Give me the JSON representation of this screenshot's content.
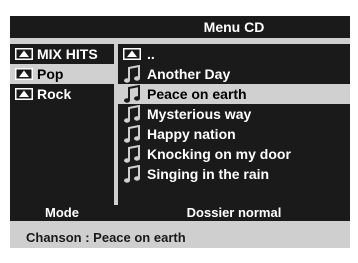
{
  "header": {
    "title": "Menu CD"
  },
  "folders": [
    {
      "label": "MIX HITS",
      "icon": "folder-icon"
    },
    {
      "label": "Pop",
      "icon": "folder-icon",
      "selected": true
    },
    {
      "label": "Rock",
      "icon": "folder-icon"
    }
  ],
  "tracks": [
    {
      "label": "..",
      "icon": "parent-folder-icon"
    },
    {
      "label": "Another Day",
      "icon": "music-note-icon"
    },
    {
      "label": "Peace on earth",
      "icon": "music-note-icon",
      "selected": true
    },
    {
      "label": "Mysterious way",
      "icon": "music-note-icon"
    },
    {
      "label": "Happy nation",
      "icon": "music-note-icon"
    },
    {
      "label": "Knocking on my door",
      "icon": "music-note-icon"
    },
    {
      "label": "Singing in the rain",
      "icon": "music-note-icon"
    }
  ],
  "footer": {
    "mode_label": "Mode",
    "mode_value": "Dossier normal"
  },
  "status": {
    "text": "Chanson : Peace on earth"
  },
  "colors": {
    "panel": "#1a1a1a",
    "frame": "#cfcfcf",
    "highlight": "#d0d0d0",
    "text": "#ffffff"
  }
}
